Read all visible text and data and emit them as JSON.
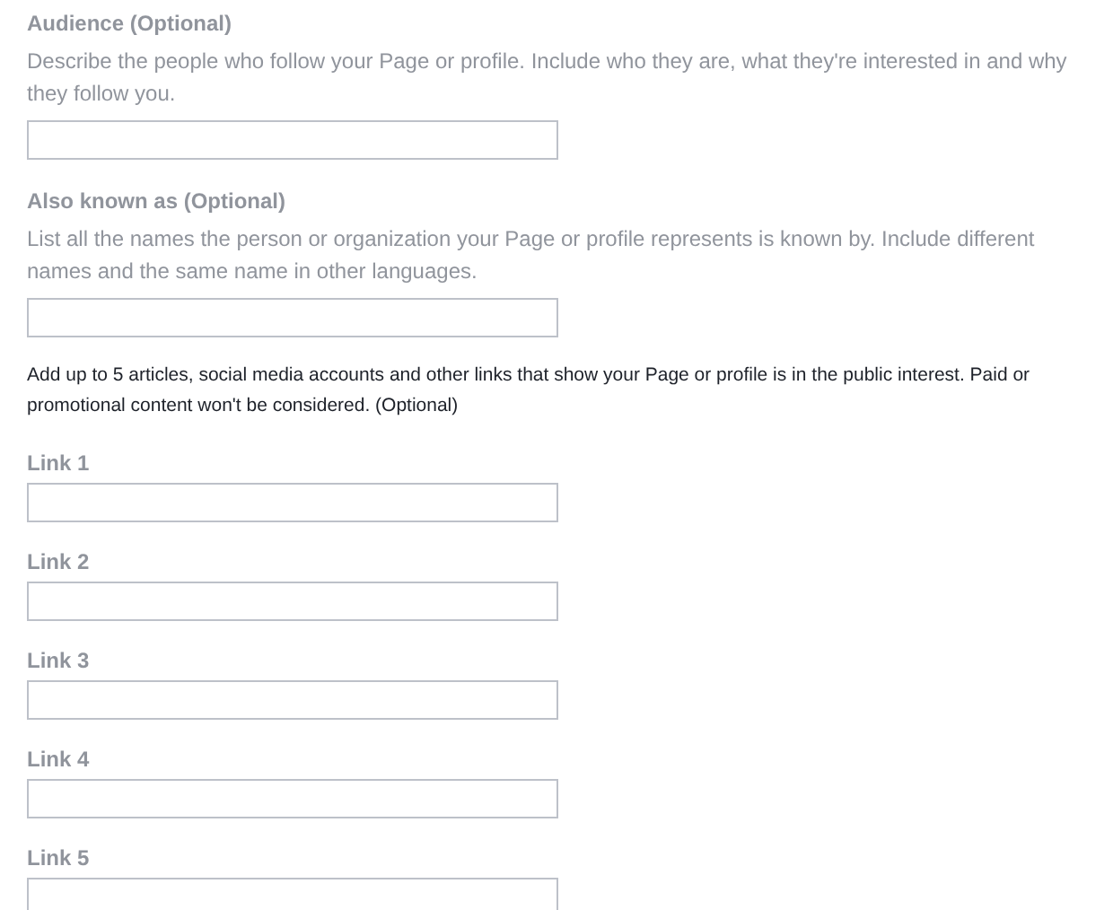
{
  "sections": [
    {
      "kind": "field",
      "label": "Audience (Optional)",
      "description": "Describe the people who follow your Page or profile. Include who they are, what they're interested in and why they follow you."
    },
    {
      "kind": "field",
      "label": "Also known as (Optional)",
      "description": "List all the names the person or organization your Page or profile represents is known by. Include different names and the same name in other languages."
    },
    {
      "kind": "note",
      "text": "Add up to 5 articles, social media accounts and other links that show your Page or profile is in the public interest. Paid or promotional content won't be considered. (Optional)"
    },
    {
      "kind": "field",
      "label": "Link 1"
    },
    {
      "kind": "field",
      "label": "Link 2"
    },
    {
      "kind": "field",
      "label": "Link 3"
    },
    {
      "kind": "field",
      "label": "Link 4"
    },
    {
      "kind": "field",
      "label": "Link 5"
    }
  ]
}
